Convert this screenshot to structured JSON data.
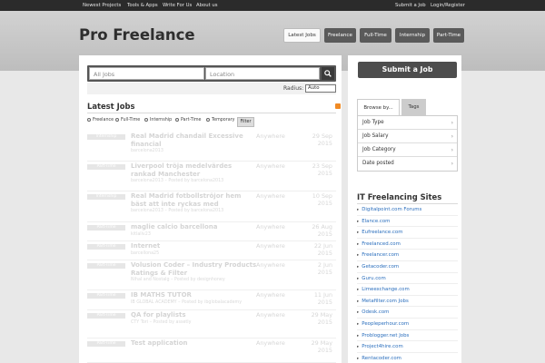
{
  "topbar": {
    "left_links": [
      "Newest Projects",
      "Tools & Apps",
      "Write For Us",
      "About us"
    ],
    "right_links": [
      "Submit a Job",
      "Login/Register"
    ]
  },
  "header": {
    "logo": "Pro Freelance",
    "nav": [
      "Latest Jobs",
      "Freelance",
      "Full-Time",
      "Internship",
      "Part-Time"
    ],
    "active_nav": "Latest Jobs"
  },
  "search": {
    "keyword_placeholder": "All Jobs",
    "location_placeholder": "Location",
    "radius_label": "Radius:",
    "radius_value": "Auto"
  },
  "jobs_section": {
    "title": "Latest Jobs",
    "filters": [
      "Freelance",
      "Full-Time",
      "Internship",
      "Part-Time",
      "Temporary"
    ],
    "filter_button": "Filter"
  },
  "jobs": [
    {
      "type": "Internship",
      "title": "Real Madrid chandail Excessive financial",
      "meta": "barcelona2013",
      "location": "Anywhere",
      "date": "29 Sep",
      "year": "2015"
    },
    {
      "type": "Part-Time",
      "title": "Liverpool tröja medelvärdes rankad Manchester",
      "meta": "barcelona2013 – Posted by barcelona2013",
      "location": "Anywhere",
      "date": "23 Sep",
      "year": "2015"
    },
    {
      "type": "Internship",
      "title": "Real Madrid fotbollströjor hem bäst att inte ryckas med",
      "meta": "barcelona2013 – Posted by barcelona2013",
      "location": "Anywhere",
      "date": "10 Sep",
      "year": "2015"
    },
    {
      "type": "Part-Time",
      "title": "maglie calcio barcellona",
      "meta": "kitlaliv23",
      "location": "Anywhere",
      "date": "26 Aug",
      "year": "2015"
    },
    {
      "type": "Part-Time",
      "title": "Internet",
      "meta": "barcellona25",
      "location": "Anywhere",
      "date": "22 Jun",
      "year": "2015"
    },
    {
      "type": "Part-Time",
      "title": "Volusion Coder – Industry Products Ratings & Filter",
      "meta": "Nihal and Nostalg – Posted by designhoney",
      "location": "Anywhere",
      "date": "2 Jun",
      "year": "2015"
    },
    {
      "type": "Part-Time",
      "title": "IB MATHS TUTOR",
      "meta": "IB GLOBAL ACADEMY – Posted by ibglobalacademy",
      "location": "Anywhere",
      "date": "11 Jun",
      "year": "2015"
    },
    {
      "type": "Part-Time",
      "title": "QA for playlists",
      "meta": "CTY Tori – Posted by assetly",
      "location": "Anywhere",
      "date": "29 May",
      "year": "2015"
    },
    {
      "type": "Part-Time",
      "title": "Test application",
      "meta": "",
      "location": "Anywhere",
      "date": "29 May",
      "year": "2015"
    }
  ],
  "sidebar": {
    "submit_label": "Submit a Job",
    "tabs": [
      "Browse by...",
      "Tags"
    ],
    "browse_items": [
      "Job Type",
      "Job Salary",
      "Job Category",
      "Date posted"
    ],
    "sites_title": "IT Freelancing Sites",
    "sites": [
      "Digitalpoint.com Forums",
      "Elance.com",
      "Eufreelance.com",
      "Freelanced.com",
      "Freelancer.com",
      "Getacoder.com",
      "Guru.com",
      "Limeexchange.com",
      "Metafilter.com Jobs",
      "Odesk.com",
      "Peopleperhour.com",
      "Problogger.net Jobs",
      "Project4hire.com",
      "Rentacoder.com"
    ]
  },
  "colors": {
    "topbar_bg": "#2b2b2b",
    "nav_button": "#5a5a5a",
    "link": "#2a6ebd",
    "rss": "#f08a24"
  },
  "icons": {
    "search_button": "search-icon",
    "rss": "rss-icon",
    "browse_item": "chevron-down-icon",
    "site_bullet": "arrow-right-icon"
  }
}
